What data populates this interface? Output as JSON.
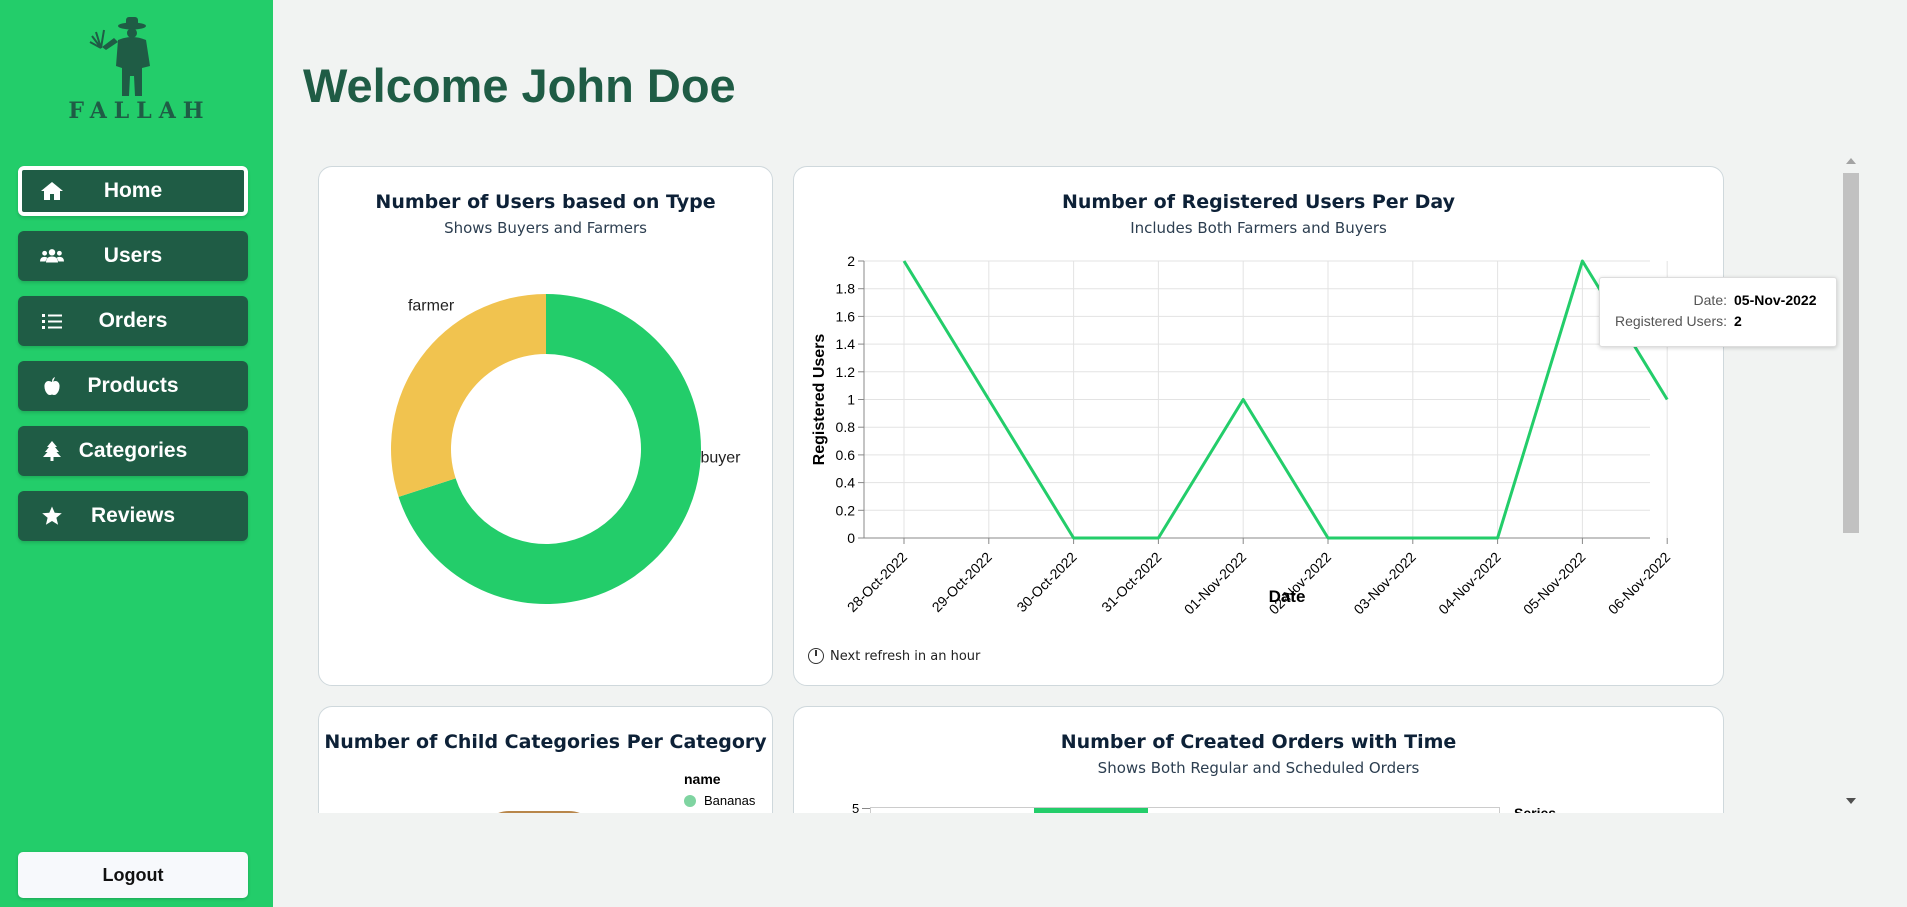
{
  "sidebar": {
    "logo_text": "FALLAH",
    "items": [
      {
        "label": "Home",
        "icon": "home-icon",
        "active": true
      },
      {
        "label": "Users",
        "icon": "users-icon",
        "active": false
      },
      {
        "label": "Orders",
        "icon": "list-icon",
        "active": false
      },
      {
        "label": "Products",
        "icon": "apple-icon",
        "active": false
      },
      {
        "label": "Categories",
        "icon": "tree-icon",
        "active": false
      },
      {
        "label": "Reviews",
        "icon": "star-icon",
        "active": false
      }
    ],
    "logout_label": "Logout"
  },
  "header": {
    "title": "Welcome John Doe"
  },
  "colors": {
    "brand_green": "#23cd6a",
    "dark_green": "#1f5c45",
    "farmer_yellow": "#f1c34f"
  },
  "panels": {
    "users_type": {
      "title": "Number of Users based on Type",
      "subtitle": "Shows Buyers and Farmers"
    },
    "registered": {
      "title": "Number of Registered Users Per Day",
      "subtitle": "Includes Both Farmers and Buyers",
      "refresh_text": "Next refresh in an hour"
    },
    "child_categories": {
      "title": "Number of Child Categories Per Category",
      "legend_title": "name",
      "legend_items": [
        "Bananas"
      ]
    },
    "orders_time": {
      "title": "Number of Created Orders with Time",
      "subtitle": "Shows Both Regular and Scheduled Orders",
      "legend_title": "Series",
      "y_top_tick": "5"
    }
  },
  "tooltip": {
    "date_label": "Date:",
    "date_value": "05-Nov-2022",
    "users_label": "Registered Users:",
    "users_value": "2"
  },
  "chart_data": [
    {
      "type": "pie",
      "title": "Number of Users based on Type",
      "subtitle": "Shows Buyers and Farmers",
      "donut": true,
      "labels": [
        "buyer",
        "farmer"
      ],
      "values": [
        7,
        3
      ],
      "colors": [
        "#23cd6a",
        "#f1c34f"
      ]
    },
    {
      "type": "line",
      "title": "Number of Registered Users Per Day",
      "subtitle": "Includes Both Farmers and Buyers",
      "xlabel": "Date",
      "ylabel": "Registered Users",
      "x": [
        "28-Oct-2022",
        "29-Oct-2022",
        "30-Oct-2022",
        "31-Oct-2022",
        "01-Nov-2022",
        "02-Nov-2022",
        "03-Nov-2022",
        "04-Nov-2022",
        "05-Nov-2022",
        "06-Nov-2022"
      ],
      "series": [
        {
          "values": [
            2,
            1,
            0,
            0,
            1,
            0,
            0,
            0,
            2,
            1
          ],
          "color": "#23cd6a"
        }
      ],
      "ylim": [
        0,
        2
      ],
      "yticks": [
        "0",
        "0.2",
        "0.4",
        "0.6",
        "0.8",
        "1",
        "1.2",
        "1.4",
        "1.6",
        "1.8",
        "2"
      ],
      "grid": true
    }
  ]
}
